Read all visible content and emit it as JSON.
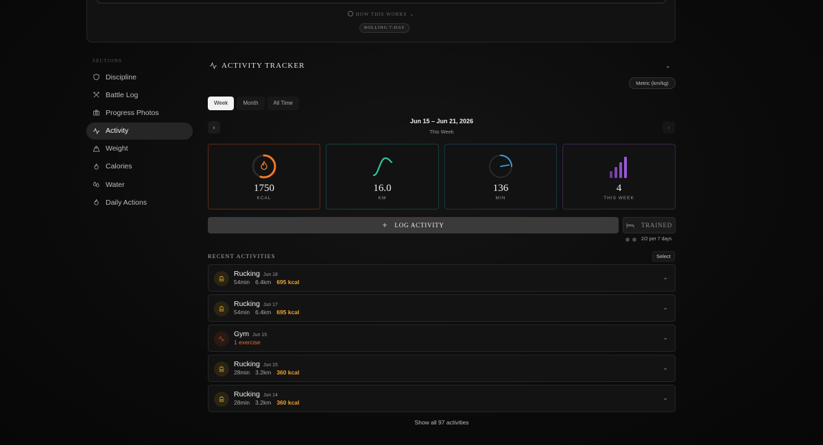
{
  "top": {
    "how_works": "HOW THIS WORKS",
    "rolling": "ROLLING 7-DAY"
  },
  "sidebar": {
    "title": "SECTIONS",
    "items": [
      {
        "label": "Discipline",
        "icon": "shield-icon"
      },
      {
        "label": "Battle Log",
        "icon": "swords-icon"
      },
      {
        "label": "Progress Photos",
        "icon": "camera-icon"
      },
      {
        "label": "Activity",
        "icon": "activity-icon",
        "active": true
      },
      {
        "label": "Weight",
        "icon": "weight-icon"
      },
      {
        "label": "Calories",
        "icon": "flame-icon"
      },
      {
        "label": "Water",
        "icon": "droplets-icon"
      },
      {
        "label": "Daily Actions",
        "icon": "flame-icon"
      }
    ]
  },
  "tracker": {
    "title": "ACTIVITY TRACKER",
    "units": "Metric (km/kg)",
    "tabs": [
      "Week",
      "Month",
      "All Time"
    ],
    "active_tab": "Week",
    "date_range": "Jun 15 – Jun 21, 2026",
    "date_sub": "This Week",
    "stats": [
      {
        "value": "1750",
        "label": "KCAL",
        "color": "#f07a28",
        "progress": 0.55
      },
      {
        "value": "16.0",
        "label": "KM",
        "color": "#2ec7a0"
      },
      {
        "value": "136",
        "label": "MIN",
        "color": "#38a0e0",
        "progress": 0.25
      },
      {
        "value": "4",
        "label": "THIS WEEK",
        "color": "#9b59d6"
      }
    ],
    "log_button": "LOG ACTIVITY",
    "trained_button": "TRAINED",
    "progress_text": "2/2 per 7 days"
  },
  "recent": {
    "title": "RECENT ACTIVITIES",
    "select_label": "Select",
    "items": [
      {
        "name": "Rucking",
        "date": "Jun 18",
        "duration": "54min",
        "distance": "6.4km",
        "kcal": "695 kcal",
        "type": "rucking"
      },
      {
        "name": "Rucking",
        "date": "Jun 17",
        "duration": "54min",
        "distance": "6.4km",
        "kcal": "695 kcal",
        "type": "rucking"
      },
      {
        "name": "Gym",
        "date": "Jun 15",
        "exercises": "1 exercise",
        "type": "gym"
      },
      {
        "name": "Rucking",
        "date": "Jun 15",
        "duration": "28min",
        "distance": "3.2km",
        "kcal": "360 kcal",
        "type": "rucking"
      },
      {
        "name": "Rucking",
        "date": "Jun 14",
        "duration": "28min",
        "distance": "3.2km",
        "kcal": "360 kcal",
        "type": "rucking"
      }
    ],
    "show_all": "Show all 97 activities"
  }
}
